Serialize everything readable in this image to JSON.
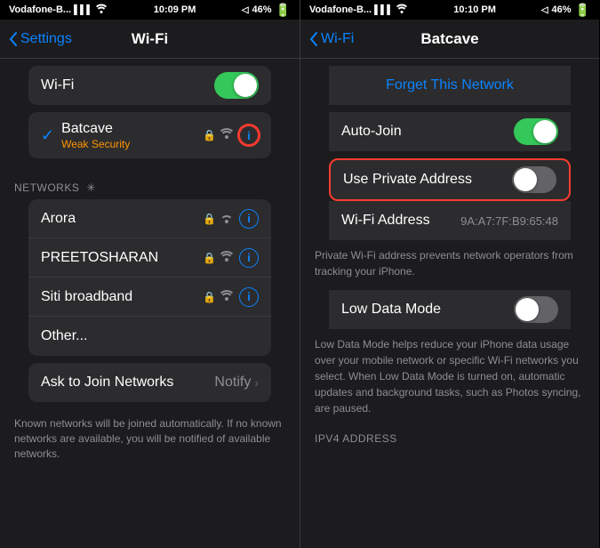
{
  "left": {
    "statusBar": {
      "carrier": "Vodafone-B...",
      "time": "10:09 PM",
      "battery": "46%"
    },
    "nav": {
      "back": "Settings",
      "title": "Wi-Fi"
    },
    "wifiToggle": {
      "label": "Wi-Fi",
      "state": "on"
    },
    "connectedNetwork": {
      "name": "Batcave",
      "subLabel": "Weak Security"
    },
    "networksHeader": "NETWORKS",
    "networks": [
      {
        "name": "Arora"
      },
      {
        "name": "PREETOSHARAN"
      },
      {
        "name": "Siti broadband"
      },
      {
        "name": "Other..."
      }
    ],
    "askLabel": "Ask to Join Networks",
    "askValue": "Notify",
    "footerText": "Known networks will be joined automatically. If no known networks are available, you will be notified of available networks."
  },
  "right": {
    "statusBar": {
      "carrier": "Vodafone-B...",
      "time": "10:10 PM",
      "battery": "46%"
    },
    "nav": {
      "back": "Wi-Fi",
      "title": "Batcave"
    },
    "forgetLabel": "Forget This Network",
    "autoJoinLabel": "Auto-Join",
    "autoJoinState": "on",
    "usePrivateLabel": "Use Private Address",
    "usePrivateState": "off",
    "wifiAddressLabel": "Wi-Fi Address",
    "wifiAddressValue": "9A:A7:7F:B9:65:48",
    "privateDesc": "Private Wi-Fi address prevents network operators from tracking your iPhone.",
    "lowDataLabel": "Low Data Mode",
    "lowDataState": "off",
    "lowDataDesc": "Low Data Mode helps reduce your iPhone data usage over your mobile network or specific Wi-Fi networks you select. When Low Data Mode is turned on, automatic updates and background tasks, such as Photos syncing, are paused.",
    "ipv4Header": "IPV4 ADDRESS"
  }
}
